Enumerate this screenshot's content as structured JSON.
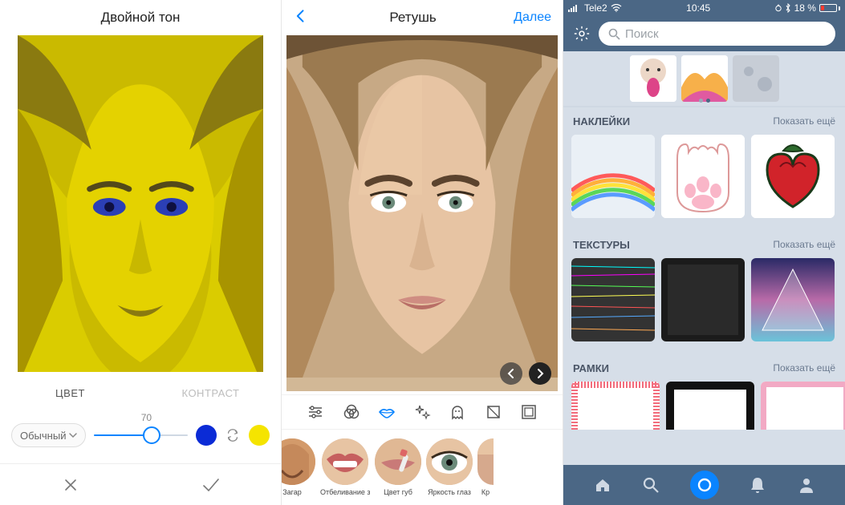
{
  "screen1": {
    "title": "Двойной тон",
    "tabs": {
      "color": "ЦВЕТ",
      "contrast": "КОНТРАСТ"
    },
    "mode_label": "Обычный",
    "slider_value": "70",
    "color_a": "#0b2bd6",
    "color_b": "#f5e400"
  },
  "screen2": {
    "title": "Ретушь",
    "next": "Далее",
    "toolbar_icons": [
      "settings-icon",
      "rings-icon",
      "lips-icon",
      "sparkle-icon",
      "ghost-icon",
      "filter-square-icon",
      "vignette-icon"
    ],
    "presets": [
      {
        "label": "Загар"
      },
      {
        "label": "Отбеливание зубов"
      },
      {
        "label": "Цвет губ"
      },
      {
        "label": "Яркость глаз"
      },
      {
        "label": "Кр"
      }
    ]
  },
  "screen3": {
    "status": {
      "carrier": "Tele2",
      "time": "10:45",
      "battery": "18 %"
    },
    "search_placeholder": "Поиск",
    "sections": {
      "stickers": {
        "title": "НАКЛЕЙКИ",
        "more": "Показать ещё"
      },
      "textures": {
        "title": "ТЕКСТУРЫ",
        "more": "Показать ещё"
      },
      "frames": {
        "title": "РАМКИ",
        "more": "Показать ещё"
      }
    }
  }
}
